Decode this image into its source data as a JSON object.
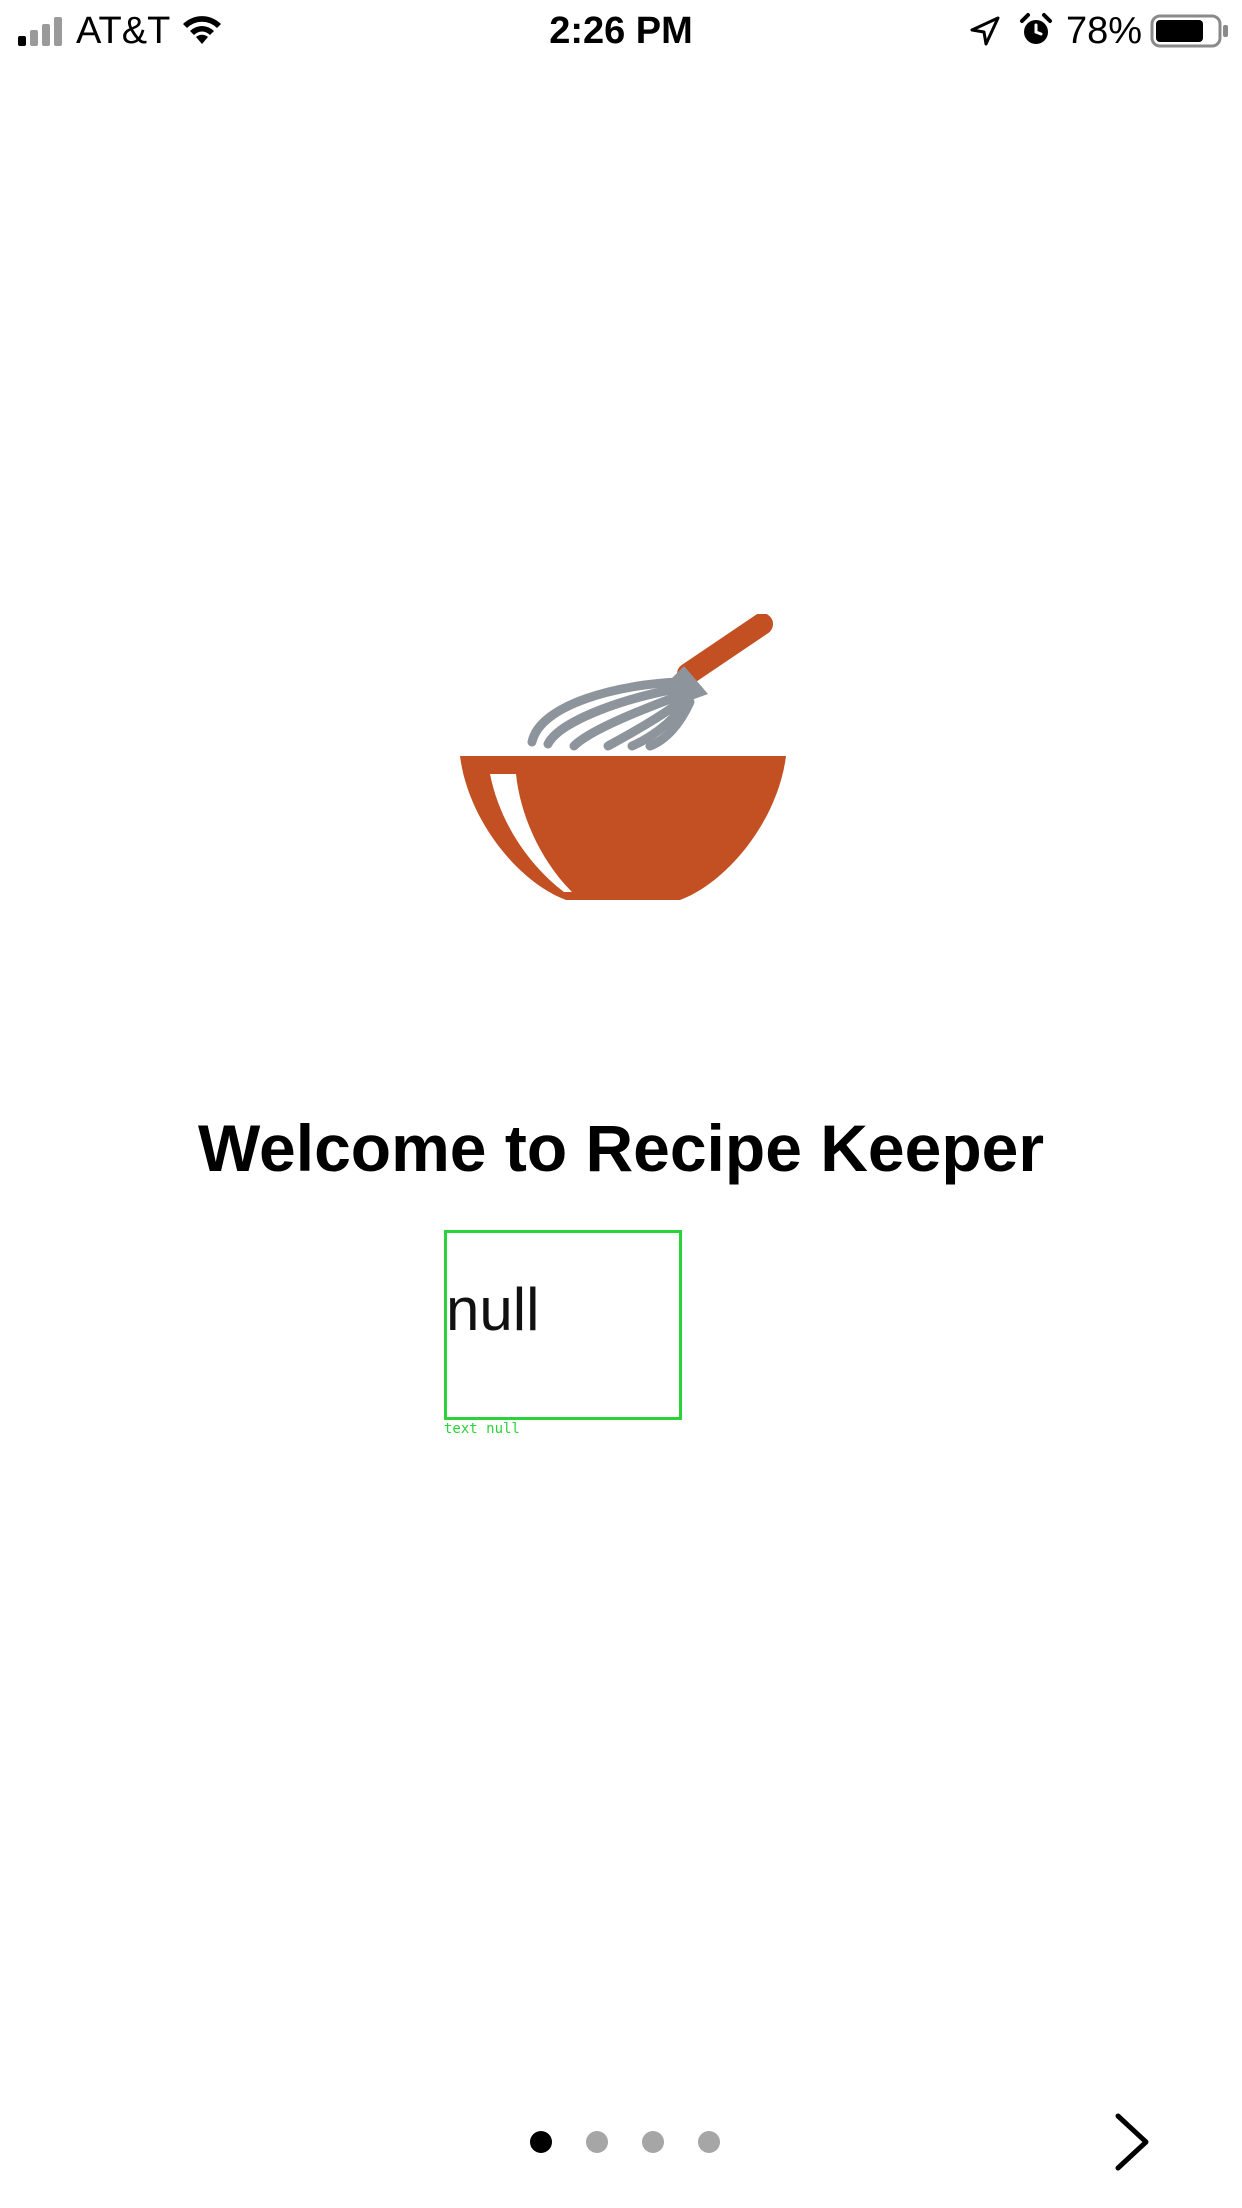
{
  "status_bar": {
    "carrier": "AT&T",
    "time": "2:26 PM",
    "battery_percent": "78%",
    "icons": [
      "signal-icon",
      "wifi-icon",
      "location-arrow-icon",
      "alarm-icon",
      "battery-icon"
    ],
    "battery_level": 0.78
  },
  "logo": {
    "icon": "mixing-bowl-whisk-icon",
    "colors": {
      "bowl": "#c35023",
      "whisk": "#8e949b",
      "handle": "#c35023"
    }
  },
  "welcome": {
    "title": "Welcome to Recipe Keeper",
    "subtitle": "null",
    "debug_caption": "text null"
  },
  "pager": {
    "total": 4,
    "current": 1
  },
  "navigation": {
    "next_icon": "chevron-right-icon"
  },
  "colors": {
    "accent": "#c35023",
    "debug_outline": "#2bd33a",
    "dot_inactive": "#a6a6a6",
    "dot_active": "#000000"
  }
}
